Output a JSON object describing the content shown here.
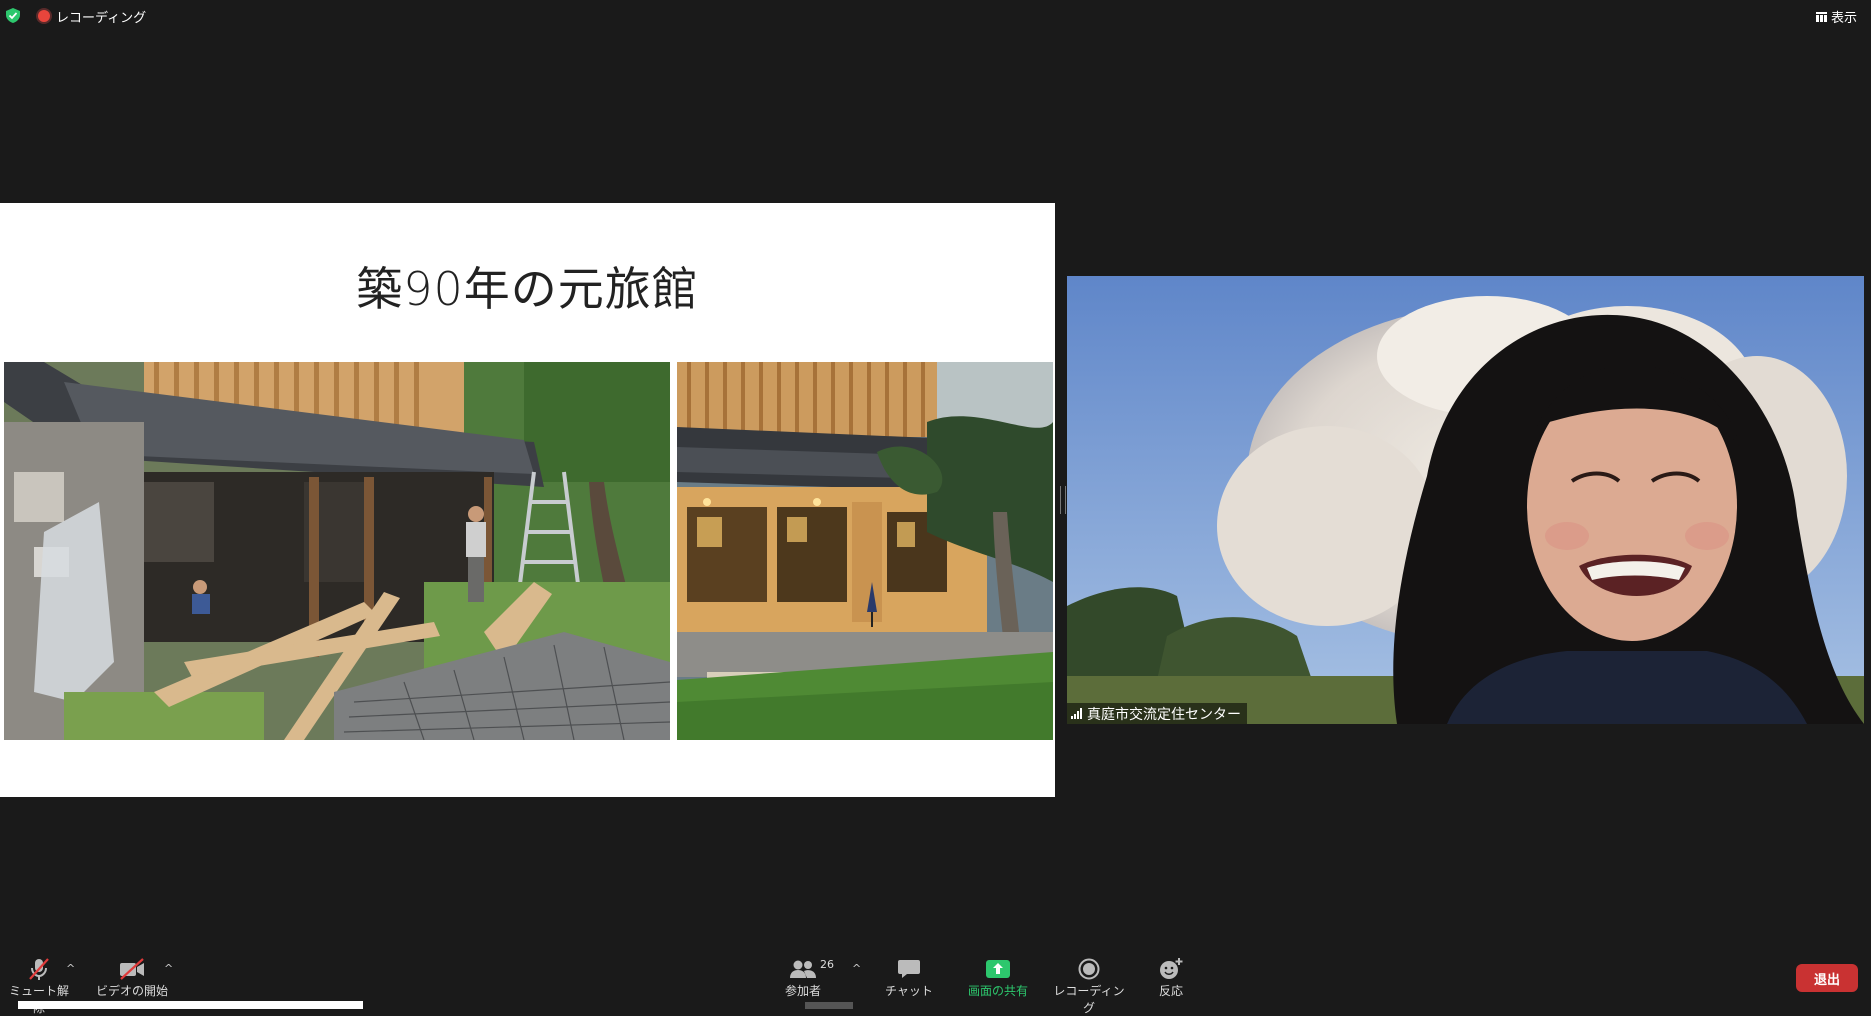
{
  "topbar": {
    "recording_label": "レコーディング",
    "view_label": "表示"
  },
  "slide": {
    "title": "築90年の元旅館"
  },
  "video": {
    "participant_name": "真庭市交流定住センター"
  },
  "toolbar": {
    "mute_label": "ミュート解除",
    "video_label": "ビデオの開始",
    "participants_label": "参加者",
    "participants_count": "26",
    "chat_label": "チャット",
    "share_label": "画面の共有",
    "record_label": "レコーディング",
    "reactions_label": "反応",
    "leave_label": "退出"
  },
  "colors": {
    "background": "#1a1a1a",
    "share_green": "#2dc76d",
    "leave_red": "#c93232",
    "recording_red": "#e8453c"
  }
}
